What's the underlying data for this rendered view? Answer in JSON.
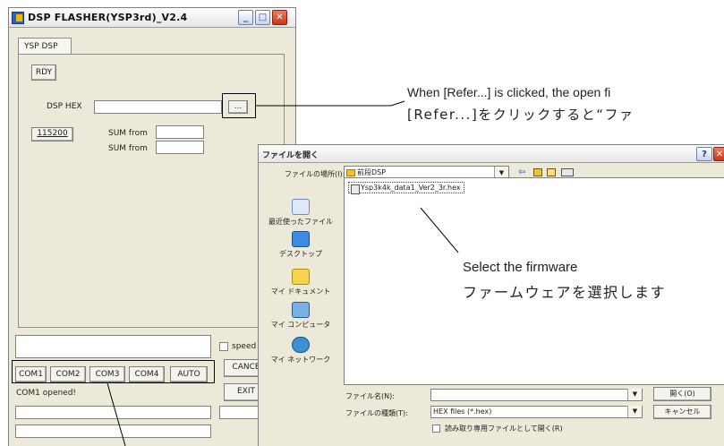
{
  "flasher": {
    "title": "DSP FLASHER(YSP3rd)_V2.4",
    "tab_label": "YSP DSP",
    "rdy_label": "RDY",
    "dsp_hex_label": "DSP HEX",
    "dsp_hex_value": "",
    "browse_label": "...",
    "baud_label": "115200",
    "sum_from_label_1": "SUM from",
    "sum_from_label_2": "SUM from",
    "speed_label": "speed",
    "cancel_label": "CANCE",
    "exit_label": "EXIT",
    "com_buttons": [
      "COM1",
      "COM2",
      "COM3",
      "COM4",
      "AUTO"
    ],
    "status_text": "COM1 opened!"
  },
  "open_dialog": {
    "title": "ファイルを開く",
    "look_in_label": "ファイルの場所(I):",
    "look_in_value": "前段DSP",
    "places": [
      "最近使ったファイル",
      "デスクトップ",
      "マイ ドキュメント",
      "マイ コンピュータ",
      "マイ ネットワーク"
    ],
    "files": [
      "Ysp3k4k_data1_Ver2_3r.hex"
    ],
    "file_name_label": "ファイル名(N):",
    "file_name_value": "",
    "file_type_label": "ファイルの種類(T):",
    "file_type_value": "HEX files (*.hex)",
    "readonly_label": "読み取り専用ファイルとして開く(R)",
    "open_button": "開く(O)",
    "cancel_button": "キャンセル"
  },
  "callouts": {
    "refer_en": "When [Refer...] is clicked, the open fi",
    "refer_jp": "[Refer...]をクリックすると“ファ",
    "select_en": "Select the firmware",
    "select_jp": "ファームウェアを選択します"
  }
}
